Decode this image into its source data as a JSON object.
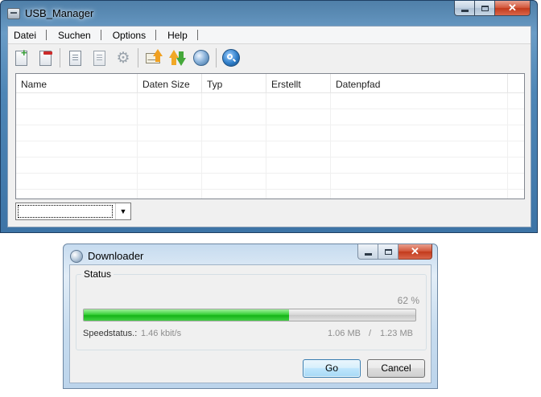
{
  "main_window": {
    "title": "USB_Manager",
    "caption_close": "✕",
    "menu": [
      "Datei",
      "Suchen",
      "Options",
      "Help"
    ],
    "toolbar_icons": [
      "new-document-icon",
      "remove-document-icon",
      "document-list-icon",
      "export-document-icon",
      "gears-icon",
      "send-mail-icon",
      "upload-download-icon",
      "globe-icon",
      "search-icon"
    ],
    "columns": [
      "Name",
      "Daten Size",
      "Typ",
      "Erstellt",
      "Datenpfad"
    ],
    "rows": 7,
    "combo": {
      "value": "",
      "arrow": "▼"
    }
  },
  "downloader": {
    "title": "Downloader",
    "caption_close": "✕",
    "status_label": "Status",
    "percent_text": "62 %",
    "progress": 0.62,
    "speed_label": "Speedstatus.:",
    "speed_value": "1.46 kbit/s",
    "size_done": "1.06 MB",
    "size_separator": "/",
    "size_total": "1.23 MB",
    "go_label": "Go",
    "cancel_label": "Cancel"
  },
  "colors": {
    "titlebar_blue": "#4e86b6",
    "progress_green": "#16b418",
    "close_red": "#c23a1c"
  }
}
